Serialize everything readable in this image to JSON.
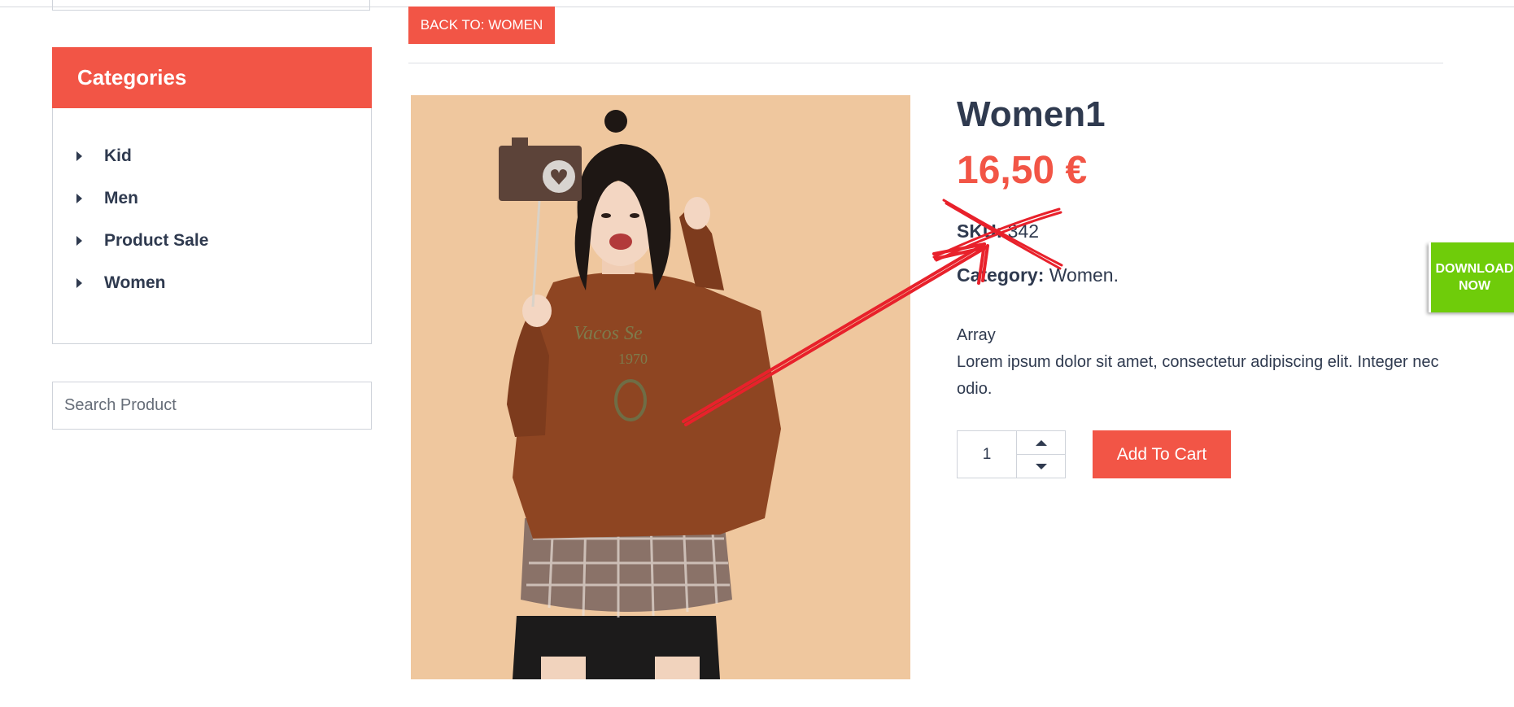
{
  "nav": {
    "back_label": "BACK TO: WOMEN"
  },
  "sidebar": {
    "categories_title": "Categories",
    "categories": [
      {
        "label": "Kid"
      },
      {
        "label": "Men"
      },
      {
        "label": "Product Sale"
      },
      {
        "label": "Women"
      }
    ],
    "search_placeholder": "Search Product"
  },
  "product": {
    "title": "Women1",
    "price": "16,50 €",
    "sku_label": "SKU:",
    "sku_value": "342",
    "category_label": "Category:",
    "category_value": "Women.",
    "description_line1": "Array",
    "description_line2": "Lorem ipsum dolor sit amet, consectetur adipiscing elit. Integer nec odio.",
    "quantity": "1",
    "add_to_cart_label": "Add To Cart"
  },
  "promo": {
    "download_label": "DOWNLOAD\nNOW"
  },
  "colors": {
    "accent": "#f25546",
    "text": "#2f3a4f",
    "download_green": "#6fcc0a",
    "annotation_red": "#e8212b",
    "photo_background": "#efc79e"
  },
  "icons": {
    "category_bullet": "caret-right-icon",
    "qty_increase": "caret-up-icon",
    "qty_decrease": "caret-down-icon",
    "camera_prop": "camera-heart-icon"
  }
}
